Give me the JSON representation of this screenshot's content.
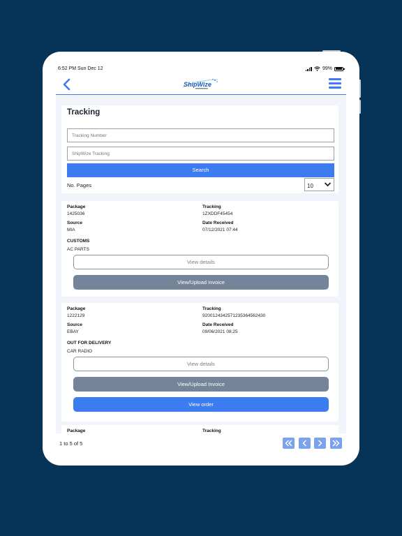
{
  "status": {
    "time": "6:52 PM  Sun Dec 12",
    "battery": "99%"
  },
  "nav": {
    "logo_text": "ShipWize"
  },
  "search": {
    "title": "Tracking",
    "tracking_placeholder": "Tracking Number",
    "shipwize_placeholder": "ShipWize Tracking",
    "search_label": "Search",
    "pages_label": "No. Pages",
    "pages_value": "10"
  },
  "labels": {
    "package": "Package",
    "tracking": "Tracking",
    "source": "Source",
    "date_received": "Date Received",
    "view_details": "View details",
    "view_upload_invoice": "View/Upload Invoice",
    "view_order": "View order"
  },
  "packages": [
    {
      "package": "1425036",
      "tracking": "1ZXDDF45454",
      "source": "MIA",
      "date_received": "07/12/2021 07:44",
      "status": "CUSTOMS",
      "description": "AC PARTS"
    },
    {
      "package": "1222129",
      "tracking": "9200124342571235364562430",
      "source": "EBAY",
      "date_received": "09/06/2021 08:25",
      "status": "OUT FOR DELIVERY",
      "description": "CAR RADIO"
    }
  ],
  "pagination": {
    "count": "1 to 5 of 5"
  },
  "colors": {
    "accent": "#3c7cf0",
    "background": "#063358",
    "gray_button": "#758599"
  }
}
